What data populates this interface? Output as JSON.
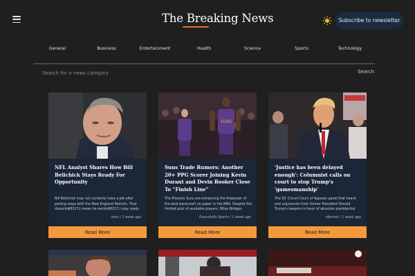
{
  "header": {
    "title": "The Breaking News",
    "subscribe_label": "Subscribe to newsletter",
    "menu_icon": "hamburger-menu-icon",
    "theme_icon": "sun-icon",
    "accent": "#e0732d"
  },
  "categories": [
    "General",
    "Business",
    "Entertainment",
    "Health",
    "Science",
    "Sports",
    "Technology"
  ],
  "search": {
    "placeholder": "Search for a news category",
    "button_label": "Search"
  },
  "articles": [
    {
      "title": "NFL Analyst Shares How Bill Belichick Stays Ready For Opportunity",
      "description": "Bill Belichick may not currently have a job after parting ways with the New England Patriots. That doesn&#8217;t mean he won&#8217;t stay ready for...",
      "source": "nesn",
      "time": "1 week ago",
      "read_more": "Read More"
    },
    {
      "title": "Suns Trade Rumors: Another 20+ PPG Scorer Joining Kevin Durant and Devin Booker Close To “Finish Line”",
      "description": "The Phoenix Suns are enhancing the firepower of the best backcourt on paper in the NBA. Despite the limited pool of available players, Miles Bridges has...",
      "source": "Essentially Sports",
      "time": "1 week ago",
      "read_more": "Read More"
    },
    {
      "title": "'Justice has been delayed enough': Columnist calls on court to stop Trump's 'gamesmanship'",
      "description": "The DC Circuit Court of Appeals panel that heard oral arguments from former President Donald Trump's lawyers in favor of absolute presidential immunity fr...",
      "source": "alternet",
      "time": "1 week ago",
      "read_more": "Read More"
    }
  ],
  "colors": {
    "background": "#1f1f1f",
    "card": "#1b2638",
    "button": "#f39a3c",
    "subscribe": "#1c2b40"
  }
}
